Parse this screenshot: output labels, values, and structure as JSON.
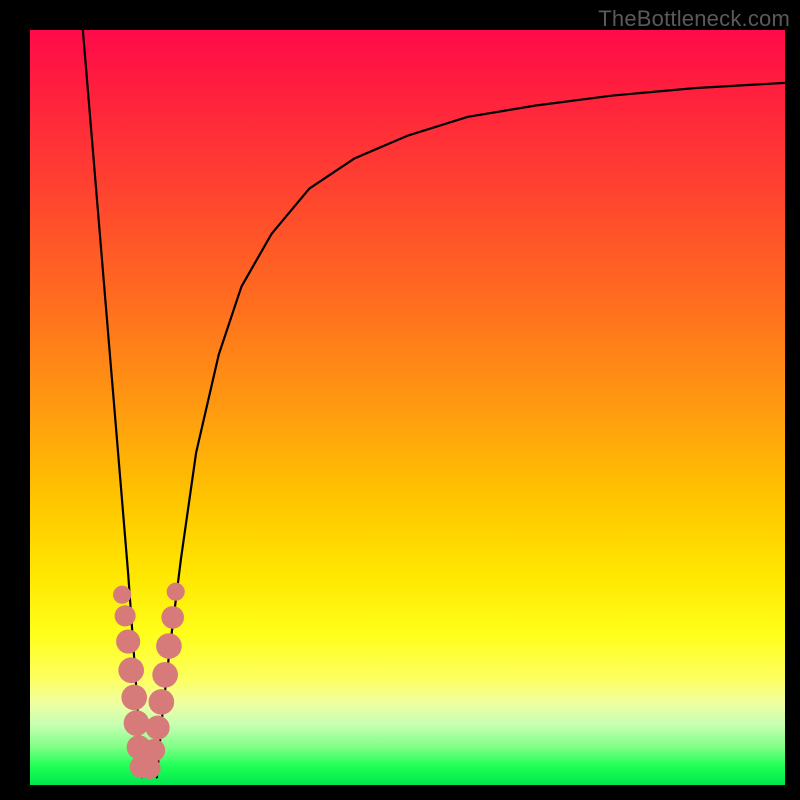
{
  "watermark": "TheBottleneck.com",
  "chart_data": {
    "type": "line",
    "title": "",
    "xlabel": "",
    "ylabel": "",
    "xlim": [
      0,
      100
    ],
    "ylim": [
      0,
      100
    ],
    "grid": false,
    "legend": false,
    "series": [
      {
        "name": "left-branch",
        "x": [
          7,
          8,
          9,
          10,
          11,
          12,
          13,
          14,
          14.8
        ],
        "values": [
          100,
          88,
          76,
          64,
          52,
          40,
          28,
          14,
          1
        ]
      },
      {
        "name": "right-branch",
        "x": [
          16.8,
          17.5,
          18.5,
          20,
          22,
          25,
          28,
          32,
          37,
          43,
          50,
          58,
          67,
          77,
          88,
          100
        ],
        "values": [
          1,
          9,
          18,
          30,
          44,
          57,
          66,
          73,
          79,
          83,
          86,
          88.5,
          90,
          91.3,
          92.3,
          93
        ]
      }
    ],
    "markers": {
      "name": "marker-cluster",
      "points": [
        {
          "x": 12.2,
          "y": 25.2,
          "r": 1.2
        },
        {
          "x": 12.6,
          "y": 22.4,
          "r": 1.4
        },
        {
          "x": 13.0,
          "y": 19.0,
          "r": 1.6
        },
        {
          "x": 13.4,
          "y": 15.2,
          "r": 1.7
        },
        {
          "x": 13.8,
          "y": 11.6,
          "r": 1.7
        },
        {
          "x": 14.1,
          "y": 8.2,
          "r": 1.7
        },
        {
          "x": 14.4,
          "y": 5.0,
          "r": 1.6
        },
        {
          "x": 14.7,
          "y": 2.4,
          "r": 1.5
        },
        {
          "x": 15.9,
          "y": 2.2,
          "r": 1.4
        },
        {
          "x": 16.4,
          "y": 4.6,
          "r": 1.5
        },
        {
          "x": 16.9,
          "y": 7.6,
          "r": 1.6
        },
        {
          "x": 17.4,
          "y": 11.0,
          "r": 1.7
        },
        {
          "x": 17.9,
          "y": 14.6,
          "r": 1.7
        },
        {
          "x": 18.4,
          "y": 18.4,
          "r": 1.7
        },
        {
          "x": 18.9,
          "y": 22.2,
          "r": 1.5
        },
        {
          "x": 19.3,
          "y": 25.6,
          "r": 1.2
        }
      ]
    }
  },
  "colors": {
    "frame": "#000000",
    "watermark": "#5a5a5a",
    "curve": "#000000",
    "marker": "#d77a7a",
    "gradient_top": "#ff0a4a",
    "gradient_bottom": "#00e84e"
  }
}
